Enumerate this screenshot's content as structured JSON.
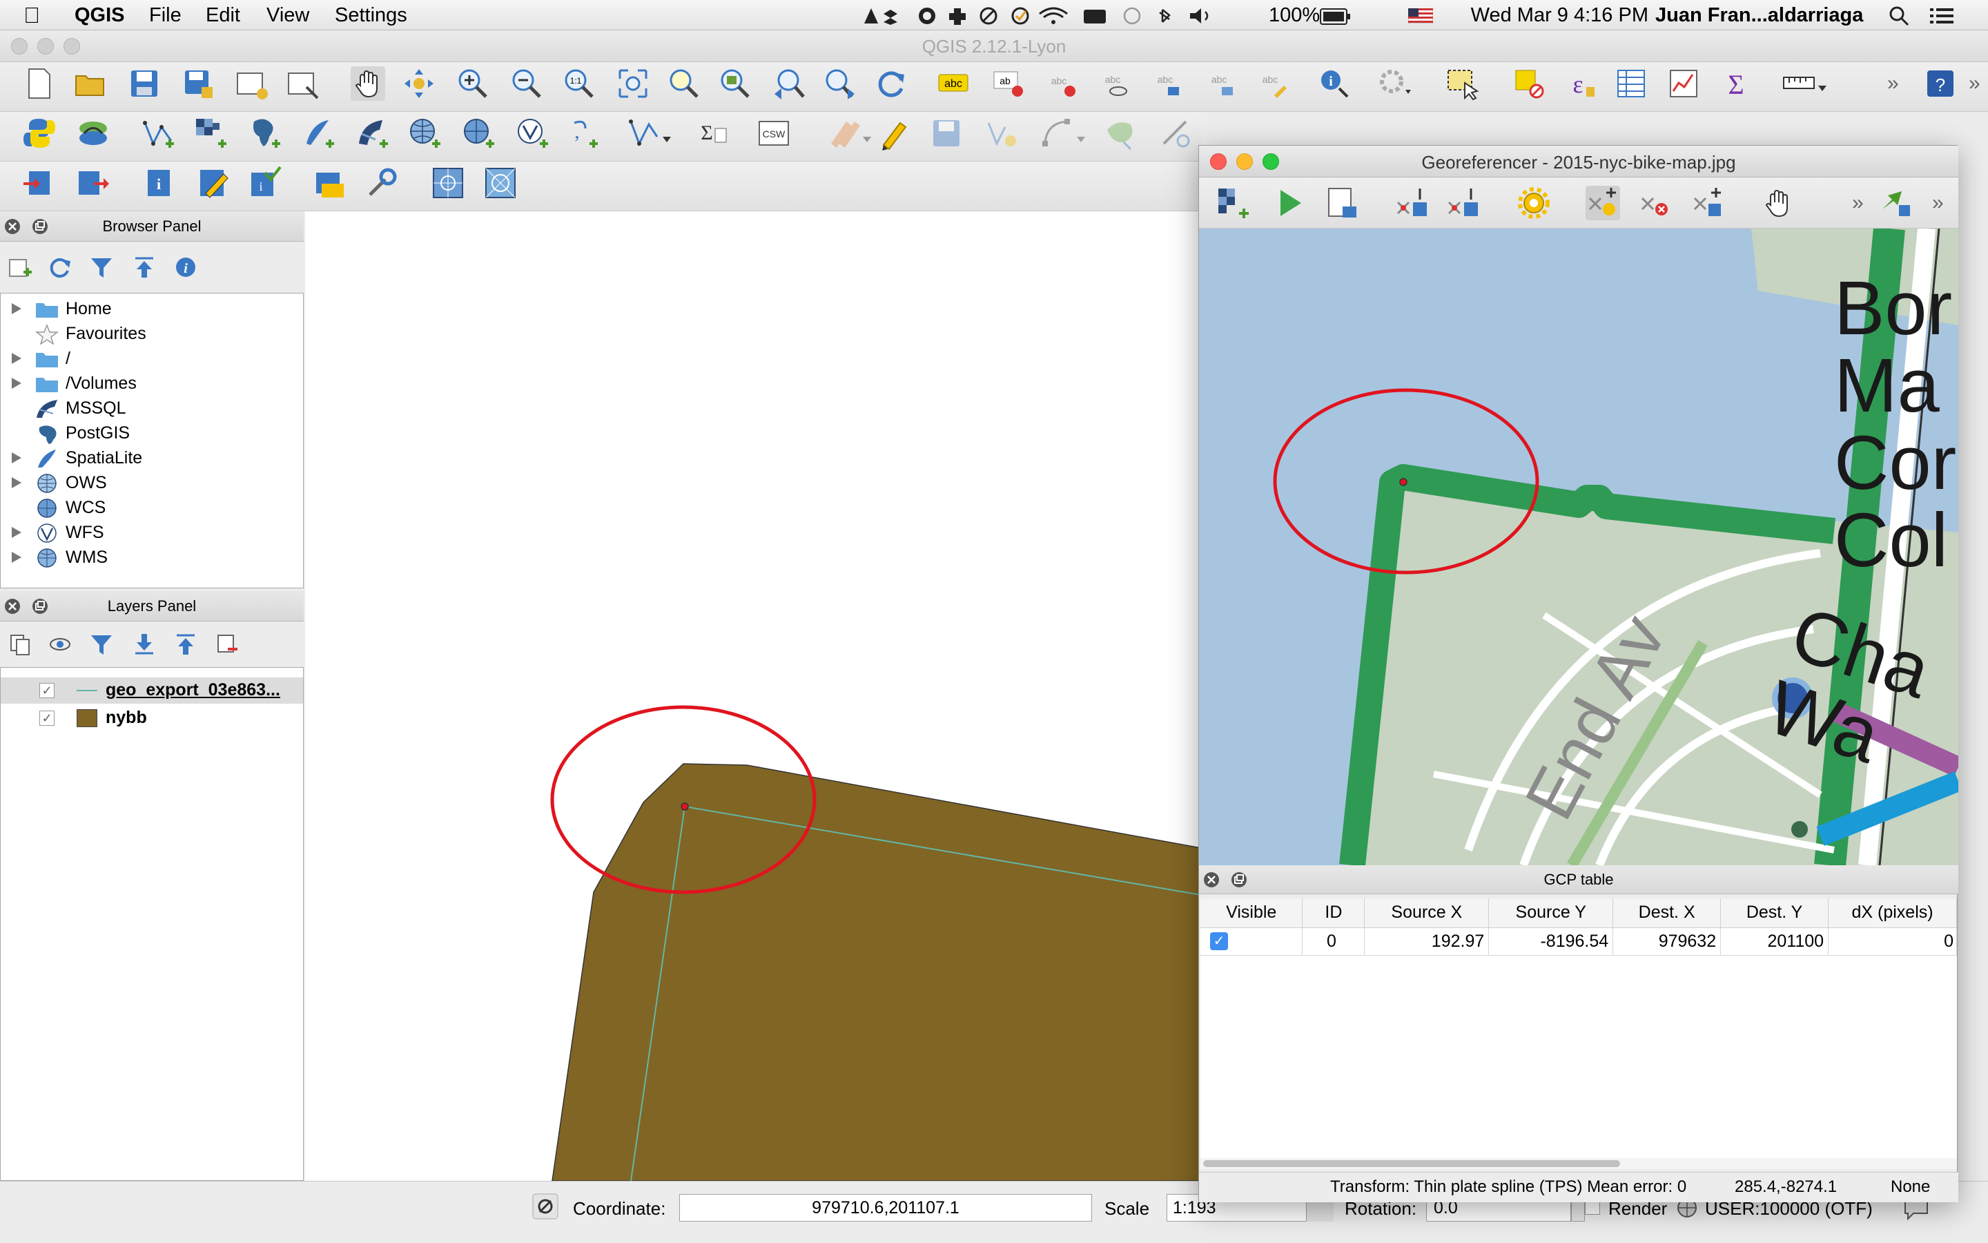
{
  "menubar": {
    "app_name": "QGIS",
    "items": [
      "File",
      "Edit",
      "View",
      "Settings"
    ],
    "battery": "100%",
    "datetime": "Wed Mar 9  4:16 PM",
    "user": "Juan Fran...aldarriaga"
  },
  "window_title": "QGIS 2.12.1-Lyon",
  "browser_panel": {
    "title": "Browser Panel",
    "items": [
      "Home",
      "Favourites",
      "/",
      "/Volumes",
      "MSSQL",
      "PostGIS",
      "SpatiaLite",
      "OWS",
      "WCS",
      "WFS",
      "WMS"
    ]
  },
  "layers_panel": {
    "title": "Layers Panel",
    "layers": [
      {
        "name": "geo_export_03e863...",
        "checked": true
      },
      {
        "name": "nybb",
        "checked": true
      }
    ]
  },
  "colors": {
    "polygon_fill": "#806524",
    "polygon_line": "#63b6a7",
    "highlight_ring": "#e0141e",
    "water": "#a8c5e0",
    "park": "#2f9a54",
    "land": "#c7d4c1"
  },
  "georeferencer": {
    "title": "Georeferencer - 2015-nyc-bike-map.jpg",
    "map_labels": {
      "text1": "Bor",
      "text2": "Ma",
      "text3": "Cor",
      "text4": "Col",
      "text5": "Cha",
      "text6": "Wa",
      "street": "End Av"
    },
    "gcp_table": {
      "title": "GCP table",
      "columns": [
        "Visible",
        "ID",
        "Source X",
        "Source Y",
        "Dest. X",
        "Dest. Y",
        "dX (pixels)"
      ],
      "rows": [
        {
          "visible": true,
          "id": "0",
          "source_x": "192.97",
          "source_y": "-8196.54",
          "dest_x": "979632",
          "dest_y": "201100",
          "dx": "0"
        }
      ]
    },
    "status": {
      "transform": "Transform: Thin plate spline (TPS) Mean error: 0",
      "coords": "285.4,-8274.1",
      "crs": "None"
    }
  },
  "statusbar": {
    "coordinate_label": "Coordinate:",
    "coordinate_value": "979710.6,201107.1",
    "scale_label": "Scale",
    "scale_value": "1:193",
    "rotation_label": "Rotation:",
    "rotation_value": "0.0",
    "render_label": "Render",
    "crs_label": "USER:100000 (OTF)"
  }
}
